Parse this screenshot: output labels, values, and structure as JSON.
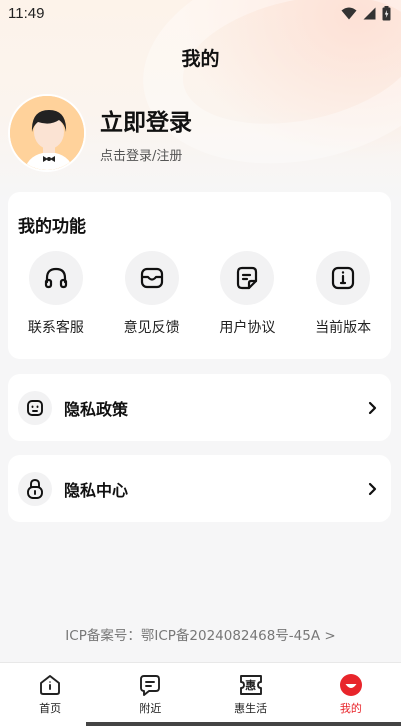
{
  "status_bar": {
    "time": "11:49",
    "icons": [
      "wifi-icon",
      "signal-icon",
      "battery-icon"
    ]
  },
  "header": {
    "title": "我的"
  },
  "profile": {
    "title": "立即登录",
    "subtitle": "点击登录/注册",
    "avatar": "avatar-illustration"
  },
  "functions": {
    "title": "我的功能",
    "items": [
      {
        "label": "联系客服",
        "icon": "headphones-icon"
      },
      {
        "label": "意见反馈",
        "icon": "inbox-icon"
      },
      {
        "label": "用户协议",
        "icon": "document-icon"
      },
      {
        "label": "当前版本",
        "icon": "info-icon"
      }
    ]
  },
  "rows": [
    {
      "label": "隐私政策",
      "icon": "privacy-face-icon"
    },
    {
      "label": "隐私中心",
      "icon": "lock-icon"
    }
  ],
  "footer": {
    "icp": "ICP备案号：鄂ICP备2024082468号-45A >"
  },
  "bottom_nav": {
    "items": [
      {
        "label": "首页",
        "icon": "home-icon",
        "active": false
      },
      {
        "label": "附近",
        "icon": "nearby-icon",
        "active": false
      },
      {
        "label": "惠生活",
        "icon": "hui-icon",
        "glyph": "惠",
        "active": false
      },
      {
        "label": "我的",
        "icon": "mine-icon",
        "active": true
      }
    ]
  },
  "colors": {
    "accent": "#e8252b",
    "avatar_bg": "#ffd29b",
    "card_bg": "#ffffff",
    "page_bg": "#f6f6f7"
  }
}
